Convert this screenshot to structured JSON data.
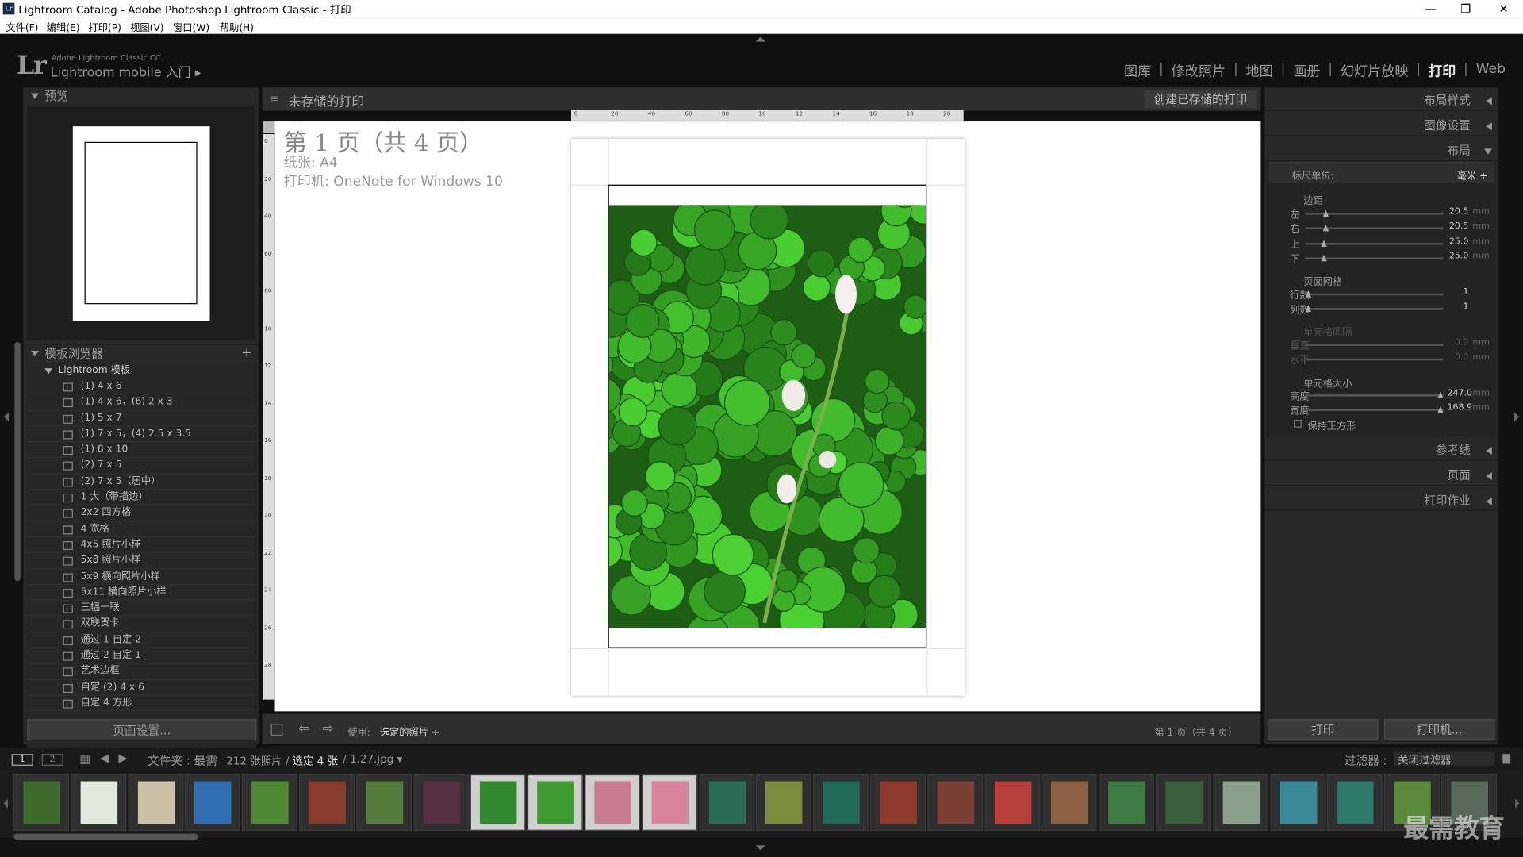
{
  "window": {
    "title": "Lightroom Catalog - Adobe Photoshop Lightroom Classic - 打印",
    "app_icon": "Lr",
    "minimize": "—",
    "maximize": "❐",
    "close": "✕"
  },
  "menu": [
    "文件(F)",
    "编辑(E)",
    "打印(P)",
    "视图(V)",
    "窗口(W)",
    "帮助(H)"
  ],
  "identity": {
    "logo": "Lr",
    "line1": "Adobe Lightroom Classic CC",
    "line2": "Lightroom mobile 入门 ▸"
  },
  "modules": [
    {
      "label": "图库",
      "active": false
    },
    {
      "label": "修改照片",
      "active": false
    },
    {
      "label": "地图",
      "active": false
    },
    {
      "label": "画册",
      "active": false
    },
    {
      "label": "幻灯片放映",
      "active": false
    },
    {
      "label": "打印",
      "active": true
    },
    {
      "label": "Web",
      "active": false
    }
  ],
  "left": {
    "preview_title": "预览",
    "template_browser_title": "模板浏览器",
    "add": "+",
    "folder": "Lightroom 模板",
    "templates": [
      "(1) 4 x 6",
      "(1) 4 x 6，(6) 2 x 3",
      "(1) 5 x 7",
      "(1) 7 x 5，(4) 2.5 x 3.5",
      "(1) 8 x 10",
      "(2) 7 x 5",
      "(2) 7 x 5（居中）",
      "1 大（带描边）",
      "2x2 四方格",
      "4 宽格",
      "4x5 照片小样",
      "5x8 照片小样",
      "5x9 横向照片小样",
      "5x11 横向照片小样",
      "三幅一联",
      "双联贺卡",
      "通过 1 自定 2",
      "通过 2 自定 1",
      "艺术边框",
      "自定 (2) 4 x 6",
      "自定 4 方形"
    ],
    "page_setup": "页面设置..."
  },
  "center": {
    "title": "未存储的打印",
    "create_saved": "创建已存储的打印",
    "page_line": "第 1 页（共 4 页）",
    "paper_line": "纸张: A4",
    "printer_line": "打印机: OneNote for Windows 10",
    "ruler_h": [
      "0",
      "20",
      "40",
      "60",
      "80",
      "10",
      "12",
      "14",
      "16",
      "18",
      "20"
    ],
    "ruler_v": [
      "0",
      "20",
      "40",
      "60",
      "80",
      "10",
      "12",
      "14",
      "16",
      "18",
      "20",
      "22",
      "24",
      "26",
      "28"
    ],
    "toolbar": {
      "use_label": "使用:",
      "use_value": "选定的照片 ÷",
      "page_count": "第 1 页（共 4 页）"
    }
  },
  "right": {
    "sections": [
      "布局样式",
      "图像设置",
      "布局"
    ],
    "ruler_units_label": "标尺单位:",
    "ruler_units_value": "毫米 ÷",
    "margins_title": "边距",
    "margins": [
      {
        "label": "左",
        "value": "20.5",
        "unit": "mm",
        "pos": 0.13
      },
      {
        "label": "右",
        "value": "20.5",
        "unit": "mm",
        "pos": 0.13
      },
      {
        "label": "上",
        "value": "25.0",
        "unit": "mm",
        "pos": 0.12
      },
      {
        "label": "下",
        "value": "25.0",
        "unit": "mm",
        "pos": 0.12
      }
    ],
    "grid_title": "页面网格",
    "grid": [
      {
        "label": "行数",
        "value": "1",
        "pos": 0.0
      },
      {
        "label": "列数",
        "value": "1",
        "pos": 0.0
      }
    ],
    "spacing_title": "单元格间隔",
    "spacing": [
      {
        "label": "垂直",
        "value": "0.0",
        "unit": "mm"
      },
      {
        "label": "水平",
        "value": "0.0",
        "unit": "mm"
      }
    ],
    "cellsize_title": "单元格大小",
    "cellsize": [
      {
        "label": "高度",
        "value": "247.0",
        "unit": "mm",
        "pos": 1.0
      },
      {
        "label": "宽度",
        "value": "168.9",
        "unit": "mm",
        "pos": 1.0
      }
    ],
    "keep_square": "保持正方形",
    "more_sections": [
      "参考线",
      "页面",
      "打印作业"
    ],
    "print": "打印",
    "printer": "打印机..."
  },
  "filmstrip": {
    "view1": "1",
    "view2": "2",
    "source": "文件夹 : 最需",
    "count": "212 张照片 /",
    "selected": "选定 4 张",
    "file": "/ 1.27.jpg ▾",
    "filter_label": "过滤器 :",
    "filter_value": "关闭过滤器",
    "thumb_colors": [
      "#3d6b2c",
      "#dfe9dc",
      "#c9c0a6",
      "#2d6fb0",
      "#4d8a33",
      "#8a3a2e",
      "#547b3c",
      "#553040",
      "#2f8a2f",
      "#3f9a2f",
      "#c97b8f",
      "#d9849c",
      "#2b6c56",
      "#7d8c3c",
      "#1f6b57",
      "#8f3a2e",
      "#7a3e35",
      "#b8403a",
      "#8a6040",
      "#3d7d45",
      "#39603a",
      "#8aa08a",
      "#3a8a9a",
      "#2d7a6a",
      "#5c8a3c",
      "#5a6a5a"
    ],
    "selected_idx": [
      8,
      9,
      10,
      11
    ]
  },
  "watermark": "最需教育"
}
